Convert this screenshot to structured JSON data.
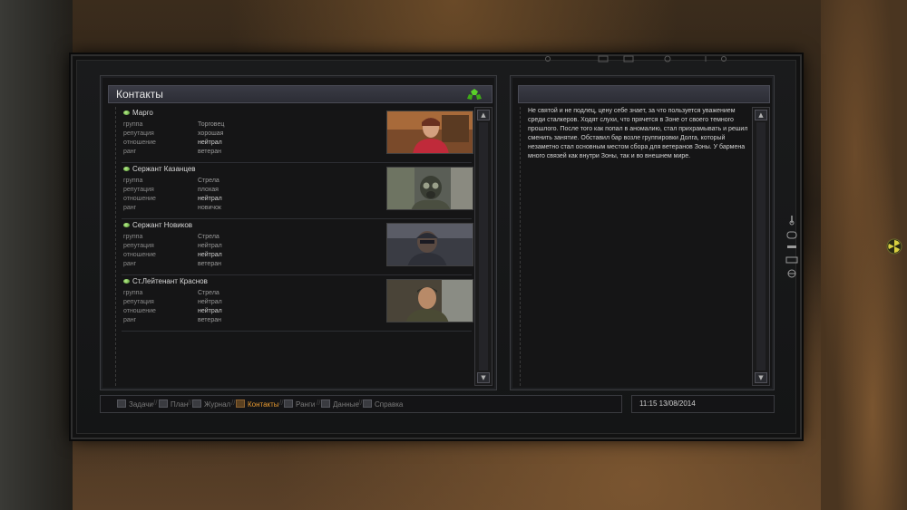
{
  "panels": {
    "contacts_title": "Контакты"
  },
  "field_labels": {
    "group": "группа",
    "reputation": "репутация",
    "attitude": "отношение",
    "rank": "ранг"
  },
  "contacts": [
    {
      "name": "Марго",
      "group": "Торговец",
      "reputation": "хорошая",
      "attitude": "нейтрал",
      "rank": "ветеран"
    },
    {
      "name": "Сержант Казанцев",
      "group": "Стрела",
      "reputation": "плохая",
      "attitude": "нейтрал",
      "rank": "новичок"
    },
    {
      "name": "Сержант Новиков",
      "group": "Стрела",
      "reputation": "нейтрал",
      "attitude": "нейтрал",
      "rank": "ветеран"
    },
    {
      "name": "Ст.Лейтенант Краснов",
      "group": "Стрела",
      "reputation": "нейтрал",
      "attitude": "нейтрал",
      "rank": "ветеран"
    }
  ],
  "description": "Не святой и не подлец, цену себе знает, за что пользуется уважением среди сталкеров. Ходят слухи, что прячется в Зоне от своего темного прошлого. После того как попал в аномалию, стал прихрамывать и решил сменить занятие. Обставил бар возле группировки Долга, который незаметно стал основным местом сбора для ветеранов Зоны. У бармена много связей как внутри Зоны, так и во внешнем мире.",
  "tabs": [
    {
      "label": "Задачи",
      "active": false
    },
    {
      "label": "План",
      "active": false
    },
    {
      "label": "Журнал",
      "active": false
    },
    {
      "label": "Контакты",
      "active": true
    },
    {
      "label": "Ранги",
      "active": false
    },
    {
      "label": "Данные",
      "active": false
    },
    {
      "label": "Справка",
      "active": false
    }
  ],
  "clock": "11:15 13/08/2014",
  "colors": {
    "active_tab": "#e89a30",
    "status_dot": "#7ac04a",
    "title_bar": "#33343d"
  },
  "icons": {
    "title": "radiation-icon",
    "scroll_up": "arrow-up-icon",
    "scroll_down": "arrow-down-icon"
  }
}
